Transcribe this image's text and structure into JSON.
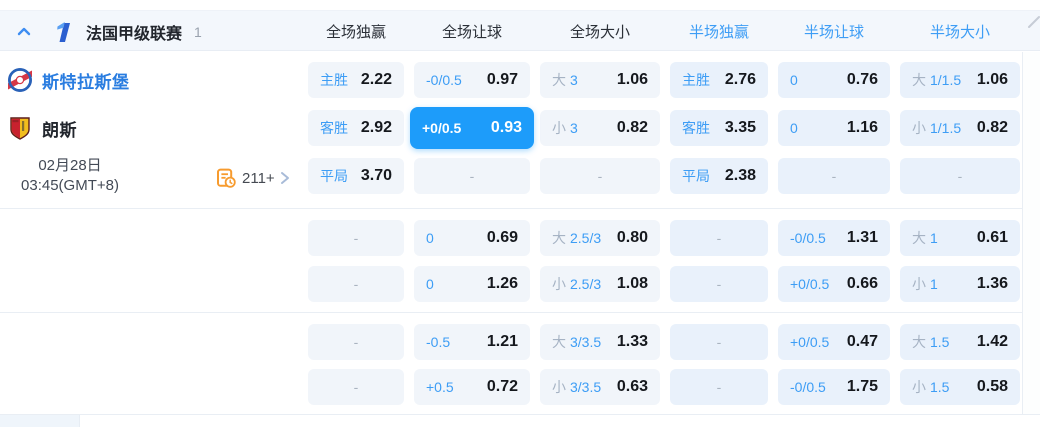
{
  "colors": {
    "selected_bg": "#1d9cfa",
    "label_blue": "#3d9df5",
    "muted_gray": "#a6b3c4",
    "odds_black": "#15181d",
    "header_band": "#f3f7fc",
    "cell_full_bg": "#f1f5fa",
    "cell_half_bg": "#e9f1fb",
    "stats_orange": "#f79b2e"
  },
  "header": {
    "collapse_icon": "chevron-up-icon",
    "league_icon": "ligue1-icon",
    "league_name": "法国甲级联赛",
    "match_count": "1",
    "columns": [
      {
        "label": "全场独赢",
        "scope": "full"
      },
      {
        "label": "全场让球",
        "scope": "full"
      },
      {
        "label": "全场大小",
        "scope": "full"
      },
      {
        "label": "半场独赢",
        "scope": "half"
      },
      {
        "label": "半场让球",
        "scope": "half"
      },
      {
        "label": "半场大小",
        "scope": "half"
      }
    ]
  },
  "match": {
    "home_name": "斯特拉斯堡",
    "away_name": "朗斯",
    "date": "02月28日",
    "time": "03:45(GMT+8)",
    "markets_count": "211+",
    "markets_icon": "match-history-icon",
    "more_icon": "chevron-right-icon"
  },
  "odds": {
    "dash": "-",
    "rows": [
      {
        "cells": [
          {
            "kind": "outcome",
            "label": "主胜",
            "value": "2.22"
          },
          {
            "kind": "handicap",
            "label": "-0/0.5",
            "value": "0.97"
          },
          {
            "kind": "total",
            "side": "大",
            "line": "3",
            "value": "1.06"
          },
          {
            "kind": "outcome",
            "label": "主胜",
            "value": "2.76"
          },
          {
            "kind": "handicap",
            "label": "0",
            "value": "0.76"
          },
          {
            "kind": "total",
            "side": "大",
            "line": "1/1.5",
            "value": "1.06"
          }
        ]
      },
      {
        "cells": [
          {
            "kind": "outcome",
            "label": "客胜",
            "value": "2.92"
          },
          {
            "kind": "handicap",
            "label": "+0/0.5",
            "value": "0.93",
            "selected": true
          },
          {
            "kind": "total",
            "side": "小",
            "line": "3",
            "value": "0.82"
          },
          {
            "kind": "outcome",
            "label": "客胜",
            "value": "3.35"
          },
          {
            "kind": "handicap",
            "label": "0",
            "value": "1.16"
          },
          {
            "kind": "total",
            "side": "小",
            "line": "1/1.5",
            "value": "0.82"
          }
        ]
      },
      {
        "cells": [
          {
            "kind": "outcome",
            "label": "平局",
            "value": "3.70"
          },
          {
            "kind": "dash"
          },
          {
            "kind": "dash"
          },
          {
            "kind": "outcome",
            "label": "平局",
            "value": "2.38"
          },
          {
            "kind": "dash"
          },
          {
            "kind": "dash"
          }
        ]
      },
      {
        "cells": [
          {
            "kind": "dash"
          },
          {
            "kind": "handicap",
            "label": "0",
            "value": "0.69"
          },
          {
            "kind": "total",
            "side": "大",
            "line": "2.5/3",
            "value": "0.80"
          },
          {
            "kind": "dash"
          },
          {
            "kind": "handicap",
            "label": "-0/0.5",
            "value": "1.31"
          },
          {
            "kind": "total",
            "side": "大",
            "line": "1",
            "value": "0.61"
          }
        ]
      },
      {
        "cells": [
          {
            "kind": "dash"
          },
          {
            "kind": "handicap",
            "label": "0",
            "value": "1.26"
          },
          {
            "kind": "total",
            "side": "小",
            "line": "2.5/3",
            "value": "1.08"
          },
          {
            "kind": "dash"
          },
          {
            "kind": "handicap",
            "label": "+0/0.5",
            "value": "0.66"
          },
          {
            "kind": "total",
            "side": "小",
            "line": "1",
            "value": "1.36"
          }
        ]
      },
      {
        "cells": [
          {
            "kind": "dash"
          },
          {
            "kind": "handicap",
            "label": "-0.5",
            "value": "1.21"
          },
          {
            "kind": "total",
            "side": "大",
            "line": "3/3.5",
            "value": "1.33"
          },
          {
            "kind": "dash"
          },
          {
            "kind": "handicap",
            "label": "+0/0.5",
            "value": "0.47"
          },
          {
            "kind": "total",
            "side": "大",
            "line": "1.5",
            "value": "1.42"
          }
        ]
      },
      {
        "cells": [
          {
            "kind": "dash"
          },
          {
            "kind": "handicap",
            "label": "+0.5",
            "value": "0.72"
          },
          {
            "kind": "total",
            "side": "小",
            "line": "3/3.5",
            "value": "0.63"
          },
          {
            "kind": "dash"
          },
          {
            "kind": "handicap",
            "label": "-0/0.5",
            "value": "1.75"
          },
          {
            "kind": "total",
            "side": "小",
            "line": "1.5",
            "value": "0.58"
          }
        ]
      }
    ]
  }
}
